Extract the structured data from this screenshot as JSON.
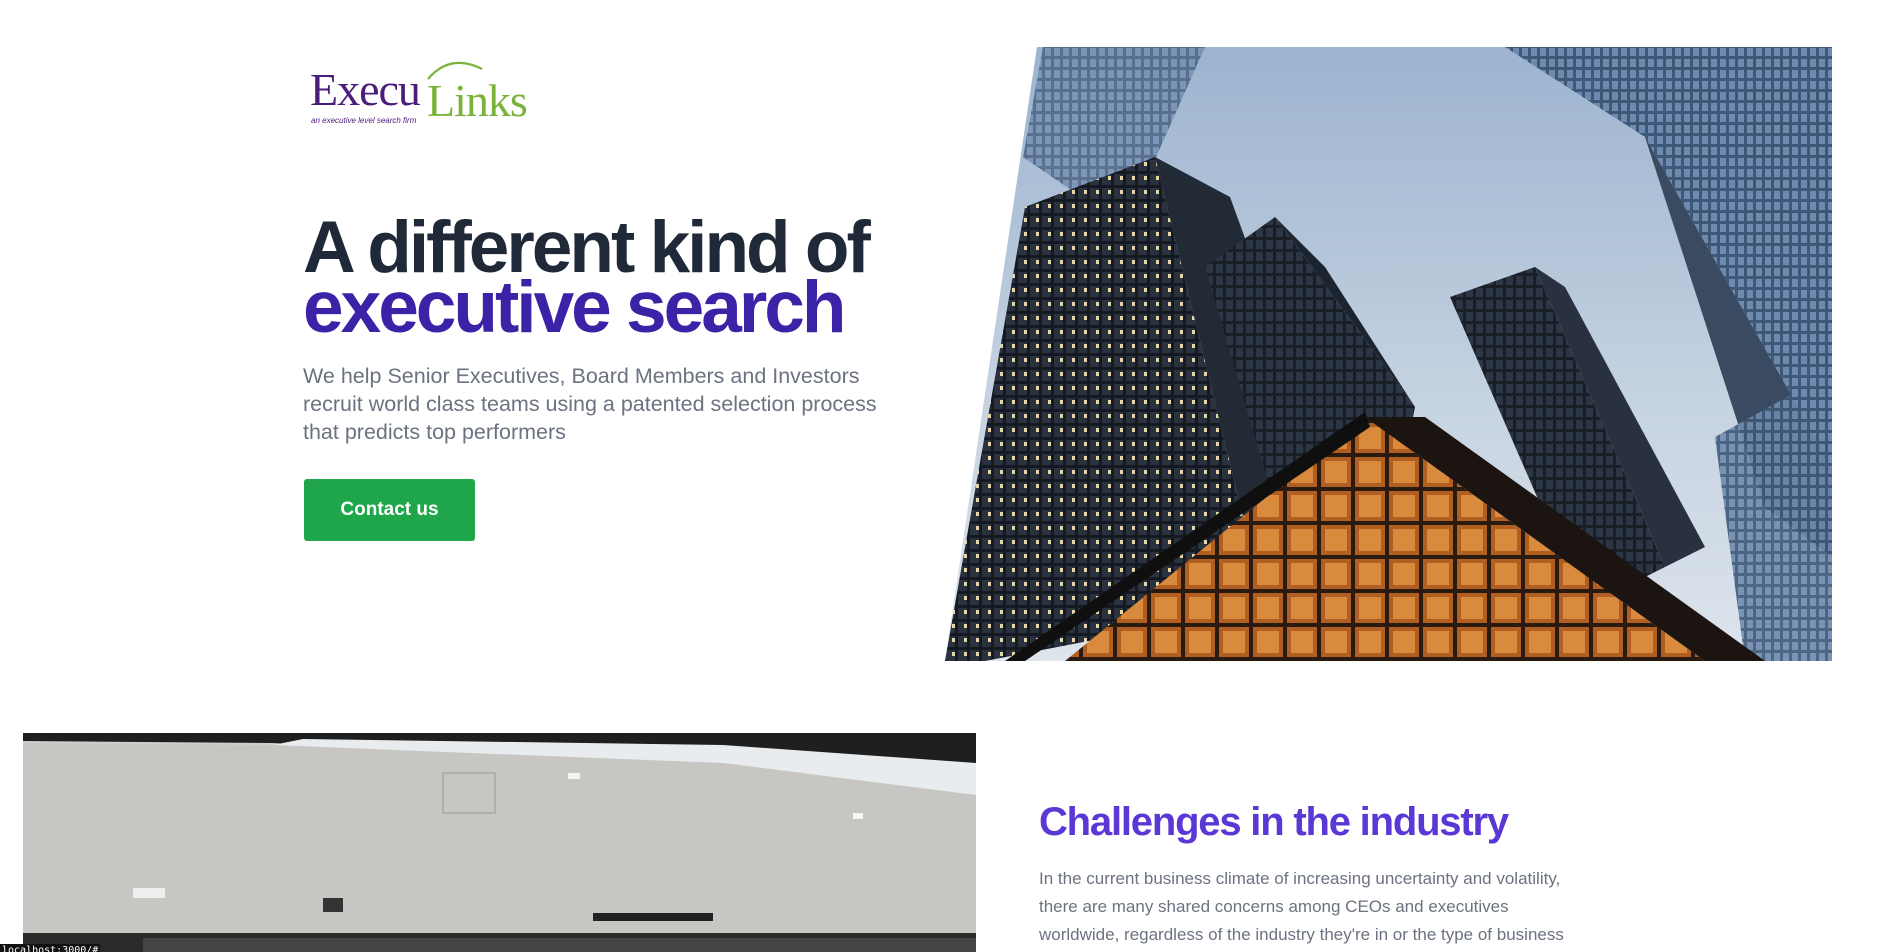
{
  "brand": {
    "logo_part1": "Execu",
    "logo_part2": "Links",
    "tagline": "an executive level search firm",
    "colors": {
      "purple": "#4b1d7a",
      "green": "#7bb33a"
    }
  },
  "hero": {
    "title_line1": "A different kind of",
    "title_line2": "executive search",
    "subtitle": "We help Senior Executives, Board Members and Investors recruit world class teams using a patented selection process that predicts top performers",
    "cta_label": "Contact us",
    "image": "skyscrapers-photo",
    "colors": {
      "title_dark": "#1f2937",
      "title_accent": "#3b22a6",
      "cta": "#1fa64a"
    }
  },
  "challenges": {
    "image": "office-interior-photo",
    "title": "Challenges in the industry",
    "body": "In the current business climate of increasing uncertainty and volatility, there are many shared concerns among CEOs and executives worldwide, regardless of the industry they're in or the type of business",
    "colors": {
      "title": "#5b37d6",
      "body": "#6b7280"
    }
  },
  "status_bar": {
    "url": "localhost:3000/#"
  }
}
